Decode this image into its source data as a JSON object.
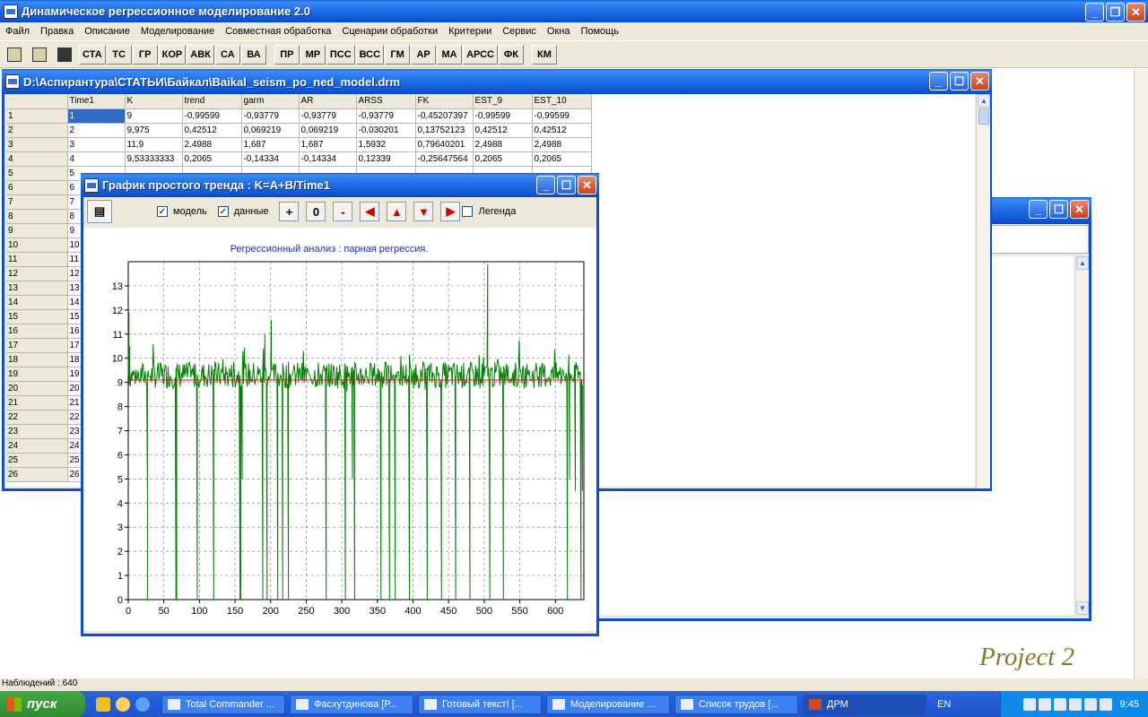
{
  "app": {
    "title": "Динамическое регрессионное моделирование 2.0"
  },
  "menu": [
    "Файл",
    "Правка",
    "Описание",
    "Моделирование",
    "Совместная обработка",
    "Сценарии обработки",
    "Критерии",
    "Сервис",
    "Окна",
    "Помощь"
  ],
  "toolbar": {
    "group1": [
      "СТА",
      "ТС",
      "ГР",
      "КОР",
      "АВК",
      "СА",
      "ВА"
    ],
    "group2": [
      "ПР",
      "МР",
      "ПСС",
      "ВСС",
      "ГМ",
      "АР",
      "МА",
      "АРСС",
      "ФК"
    ],
    "group3": [
      "КМ"
    ]
  },
  "grid_window": {
    "title": "D:\\Аспирантура\\СТАТЬИ\\Байкал\\Baikal_seism_po_ned_model.drm",
    "columns": [
      "Time1",
      "K",
      "trend",
      "garm",
      "AR",
      "ARSS",
      "FK",
      "EST_9",
      "EST_10"
    ],
    "rows": [
      [
        "1",
        "1",
        "9",
        "-0,99599",
        "-0,93779",
        "-0,93779",
        "-0,93779",
        "-0,45207397",
        "-0,99599",
        "-0,99599"
      ],
      [
        "2",
        "2",
        "9,975",
        "0,42512",
        "0,069219",
        "0,069219",
        "-0,030201",
        "0,13752123",
        "0,42512",
        "0,42512"
      ],
      [
        "3",
        "3",
        "11,9",
        "2,4988",
        "1,687",
        "1,687",
        "1,5932",
        "0,79640201",
        "2,4988",
        "2,4988"
      ],
      [
        "4",
        "4",
        "9,53333333",
        "0,2065",
        "-0,14334",
        "-0,14334",
        "0,12339",
        "-0,25647564",
        "0,2065",
        "0,2065"
      ],
      [
        "5",
        "5"
      ],
      [
        "6",
        "6"
      ],
      [
        "7",
        "7"
      ],
      [
        "8",
        "8"
      ],
      [
        "9",
        "9"
      ],
      [
        "10",
        "10"
      ],
      [
        "11",
        "11"
      ],
      [
        "12",
        "12"
      ],
      [
        "13",
        "13"
      ],
      [
        "14",
        "14"
      ],
      [
        "15",
        "15"
      ],
      [
        "16",
        "16"
      ],
      [
        "17",
        "17"
      ],
      [
        "18",
        "18"
      ],
      [
        "19",
        "19"
      ],
      [
        "20",
        "20"
      ],
      [
        "21",
        "21"
      ],
      [
        "22",
        "22"
      ],
      [
        "23",
        "23"
      ],
      [
        "24",
        "24"
      ],
      [
        "25",
        "25"
      ],
      [
        "26",
        "26"
      ]
    ]
  },
  "chart_window": {
    "title": "График простого тренда : K=A+B/Time1",
    "model_label": "модель",
    "data_label": "данные",
    "legend_label": "Легенда",
    "zoom_in": "+",
    "zoom_reset": "0",
    "zoom_out": "-"
  },
  "chart_data": {
    "type": "line",
    "title": "Регрессионный анализ : парная регрессия.",
    "xlim": [
      0,
      640
    ],
    "ylim": [
      0,
      14
    ],
    "x_ticks": [
      0,
      50,
      100,
      150,
      200,
      250,
      300,
      350,
      400,
      450,
      500,
      550,
      600
    ],
    "y_ticks": [
      0,
      1,
      2,
      3,
      4,
      5,
      6,
      7,
      8,
      9,
      10,
      11,
      12,
      13
    ],
    "grid": true,
    "series": [
      {
        "color": "#ff0000",
        "x": [
          0,
          640
        ],
        "y": [
          9.1,
          9.1
        ]
      },
      {
        "color": "#008000",
        "baseline": 9.3,
        "spikes": [
          [
            1,
            11.9
          ],
          [
            2,
            10.5
          ],
          [
            27,
            4.5
          ],
          [
            27,
            0
          ],
          [
            67,
            0
          ],
          [
            68,
            4.5
          ],
          [
            68,
            0
          ],
          [
            97,
            0
          ],
          [
            120,
            0
          ],
          [
            157,
            0
          ],
          [
            158,
            6
          ],
          [
            158,
            0
          ],
          [
            160,
            5
          ],
          [
            189,
            0
          ],
          [
            190,
            10.4
          ],
          [
            192,
            11
          ],
          [
            195,
            0
          ],
          [
            199,
            9.2
          ],
          [
            201,
            11.6
          ],
          [
            210,
            0
          ],
          [
            217,
            0
          ],
          [
            225,
            0
          ],
          [
            278,
            0
          ],
          [
            305,
            0
          ],
          [
            315,
            5
          ],
          [
            318,
            0
          ],
          [
            355,
            0
          ],
          [
            367,
            0
          ],
          [
            375,
            0
          ],
          [
            395,
            0
          ],
          [
            420,
            0
          ],
          [
            440,
            0
          ],
          [
            460,
            0
          ],
          [
            480,
            0
          ],
          [
            505,
            13.9
          ],
          [
            508,
            0
          ],
          [
            527,
            0
          ],
          [
            617,
            0
          ],
          [
            620,
            5
          ],
          [
            628,
            4.5
          ],
          [
            636,
            0
          ],
          [
            638,
            4.5
          ]
        ]
      }
    ]
  },
  "right_window": {
    "title": ""
  },
  "watermark": "Project 2",
  "status": "Наблюдений : 640",
  "taskbar": {
    "start": "пуск",
    "tasks": [
      "Total Commander ...",
      "Фасхутдинова [Р...",
      "Готовый текст! [...",
      "Моделирование ...",
      "Список трудов [...",
      "ДРМ"
    ],
    "lang": "EN",
    "clock": "9:45"
  },
  "colors": {
    "title_bar": "#1f6ee8",
    "taskbar": "#245edb",
    "model_line": "#ff0000",
    "data_line": "#008000",
    "chart_title": "#1a2acc"
  }
}
